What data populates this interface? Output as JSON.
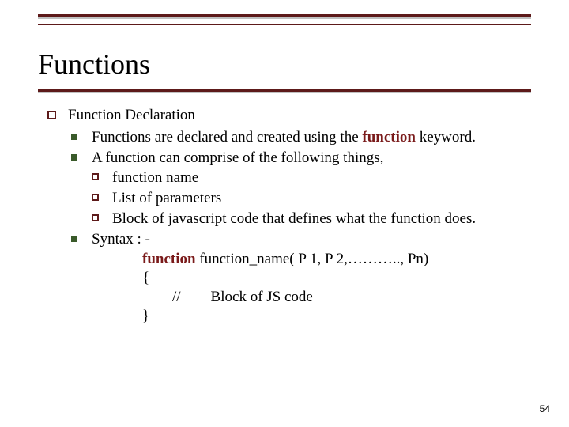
{
  "title": "Functions",
  "section": "Function Declaration",
  "b1_pre": "Functions are declared and created using the ",
  "b1_kw": "function",
  "b1_post": " keyword.",
  "b2": "A function can comprise of the following things,",
  "s1": "function name",
  "s2": "List of parameters",
  "s3": "Block of javascript code that defines what the function does.",
  "b3": "Syntax : -",
  "syn_kw": "function",
  "syn_sig": " function_name( P 1, P 2,……….., Pn)",
  "syn_open": "{",
  "syn_body": "        //        Block of JS code",
  "syn_close": "}",
  "page": "54"
}
